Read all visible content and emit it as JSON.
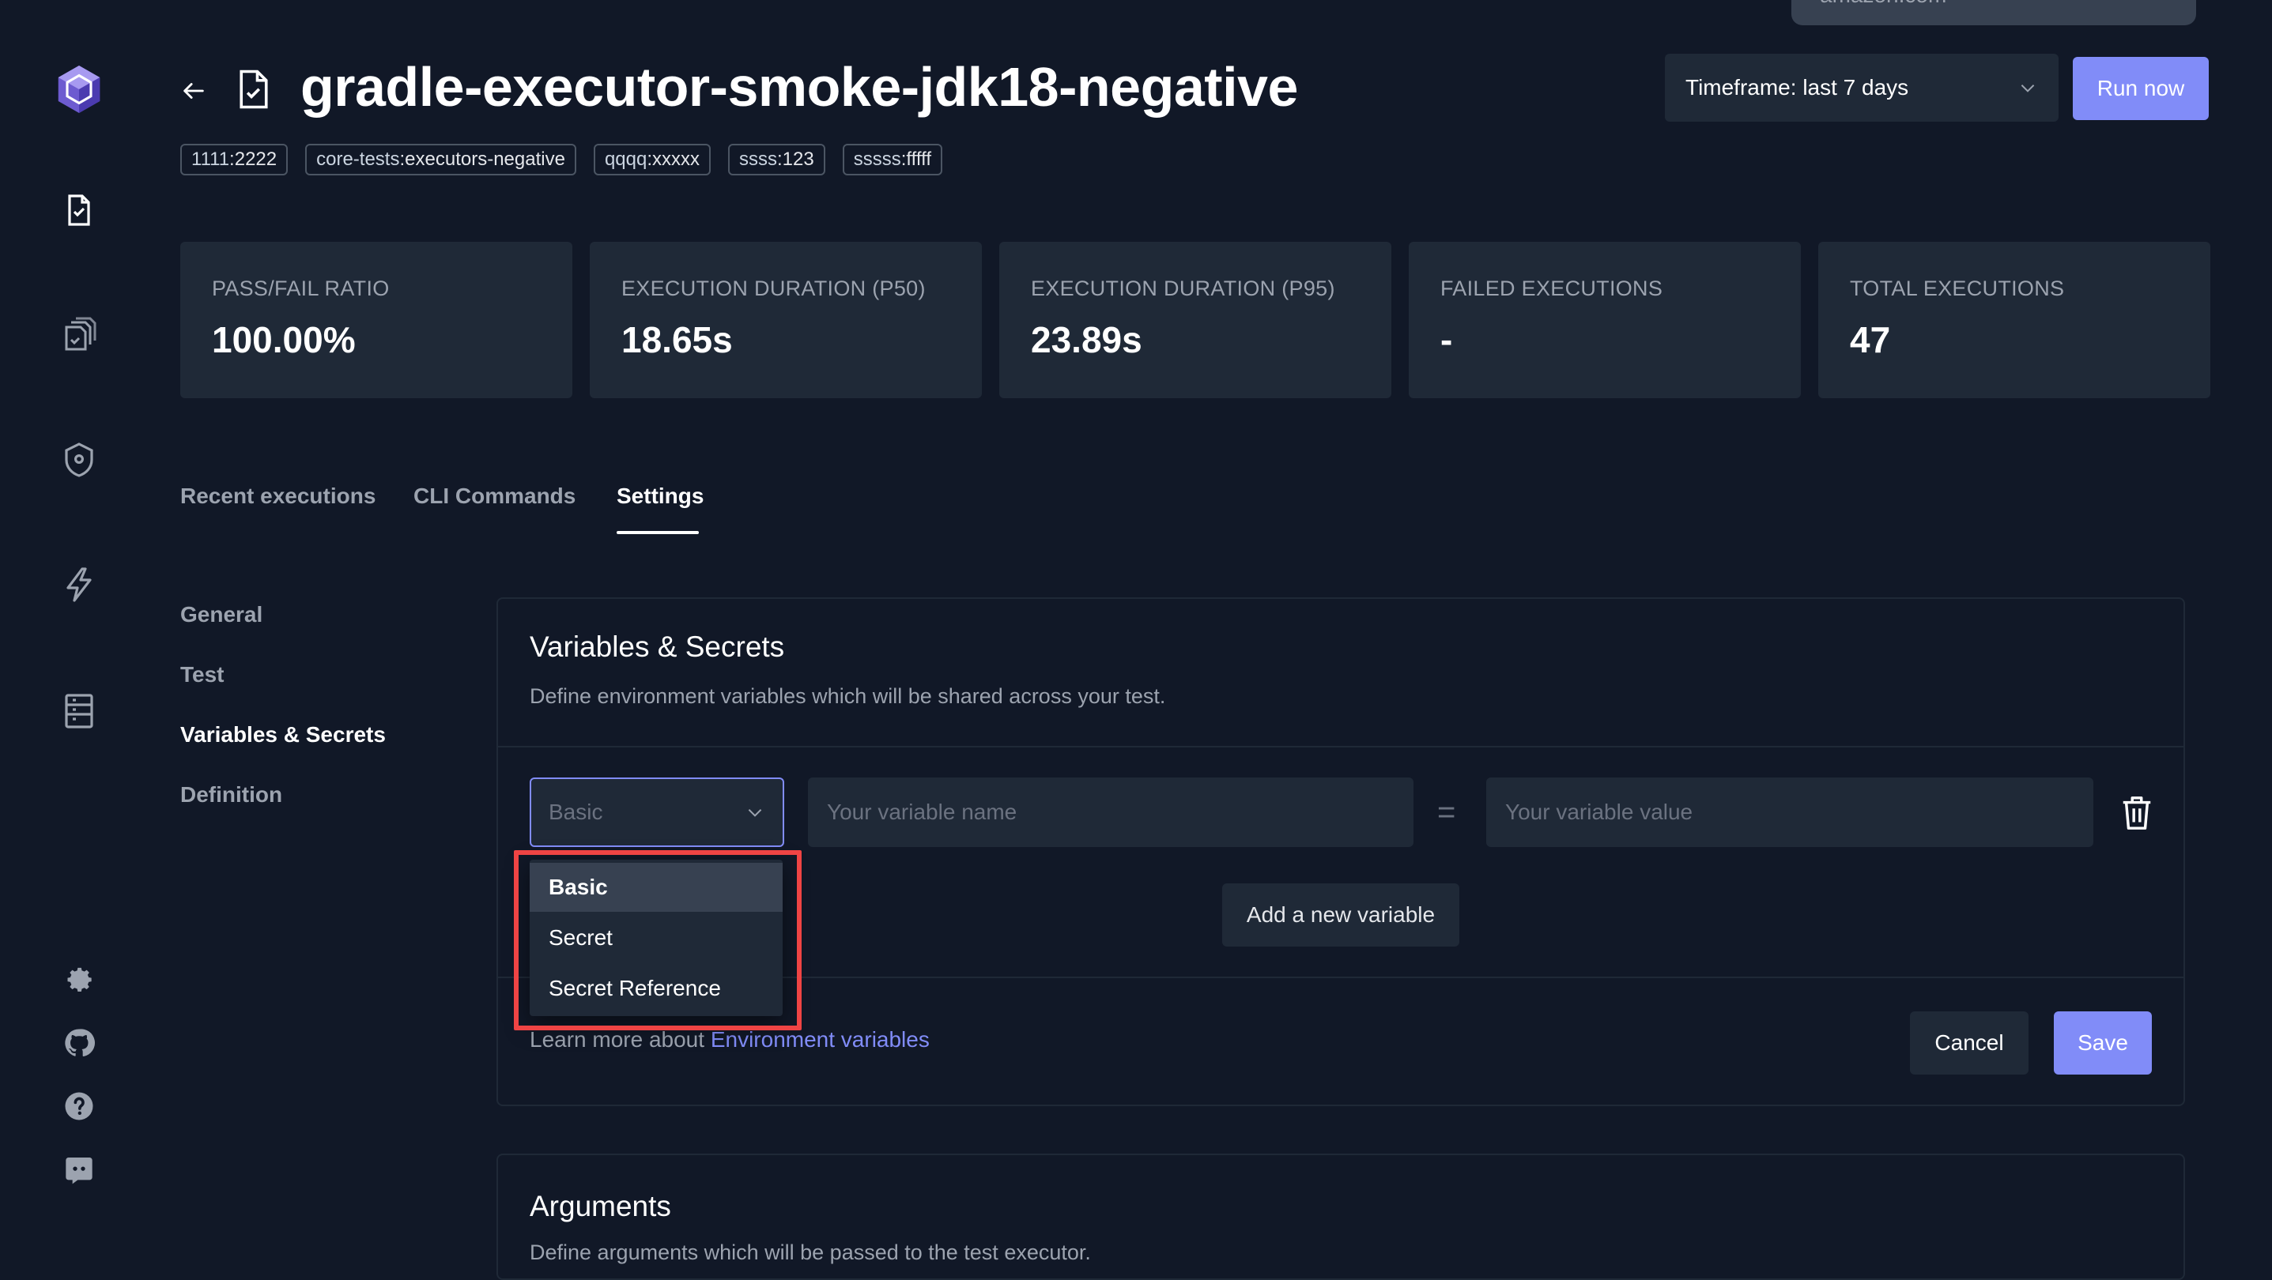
{
  "top_pill": "amazon.com",
  "header": {
    "title": "gradle-executor-smoke-jdk18-negative",
    "labels": [
      {
        "key": "1111",
        "value": "2222"
      },
      {
        "key": "core-tests",
        "value": "executors-negative"
      },
      {
        "key": "qqqq",
        "value": "xxxxx"
      },
      {
        "key": "ssss",
        "value": "123"
      },
      {
        "key": "sssss",
        "value": "fffff"
      }
    ],
    "timeframe": "Timeframe: last 7 days",
    "run_now": "Run now"
  },
  "metrics": [
    {
      "label": "PASS/FAIL RATIO",
      "value": "100.00%"
    },
    {
      "label": "EXECUTION DURATION (P50)",
      "value": "18.65s"
    },
    {
      "label": "EXECUTION DURATION (P95)",
      "value": "23.89s"
    },
    {
      "label": "FAILED EXECUTIONS",
      "value": "-"
    },
    {
      "label": "TOTAL EXECUTIONS",
      "value": "47"
    }
  ],
  "tabs": [
    "Recent executions",
    "CLI Commands",
    "Settings"
  ],
  "settings_nav": [
    "General",
    "Test",
    "Variables & Secrets",
    "Definition"
  ],
  "variables": {
    "title": "Variables & Secrets",
    "description": "Define environment variables which will be shared across your test.",
    "type_value": "Basic",
    "name_placeholder": "Your variable name",
    "equals": "=",
    "value_placeholder": "Your variable value",
    "add_button": "Add a new variable",
    "learn_prefix": "Learn more about",
    "learn_link": "Environment variables",
    "cancel": "Cancel",
    "save": "Save",
    "dropdown_options": [
      "Basic",
      "Secret",
      "Secret Reference"
    ]
  },
  "arguments": {
    "title": "Arguments",
    "description": "Define arguments which will be passed to the test executor."
  },
  "colors": {
    "background": "#111827",
    "card": "#1f2937",
    "accent": "#818cf8",
    "highlight": "#ef4444"
  },
  "icons": {
    "logo": "testkube-logo-icon",
    "sidebar": [
      "test-file-icon",
      "test-suites-icon",
      "executors-shield-icon",
      "triggers-bolt-icon",
      "sources-list-icon",
      "settings-gear-icon",
      "github-icon",
      "help-icon",
      "discord-icon"
    ]
  }
}
